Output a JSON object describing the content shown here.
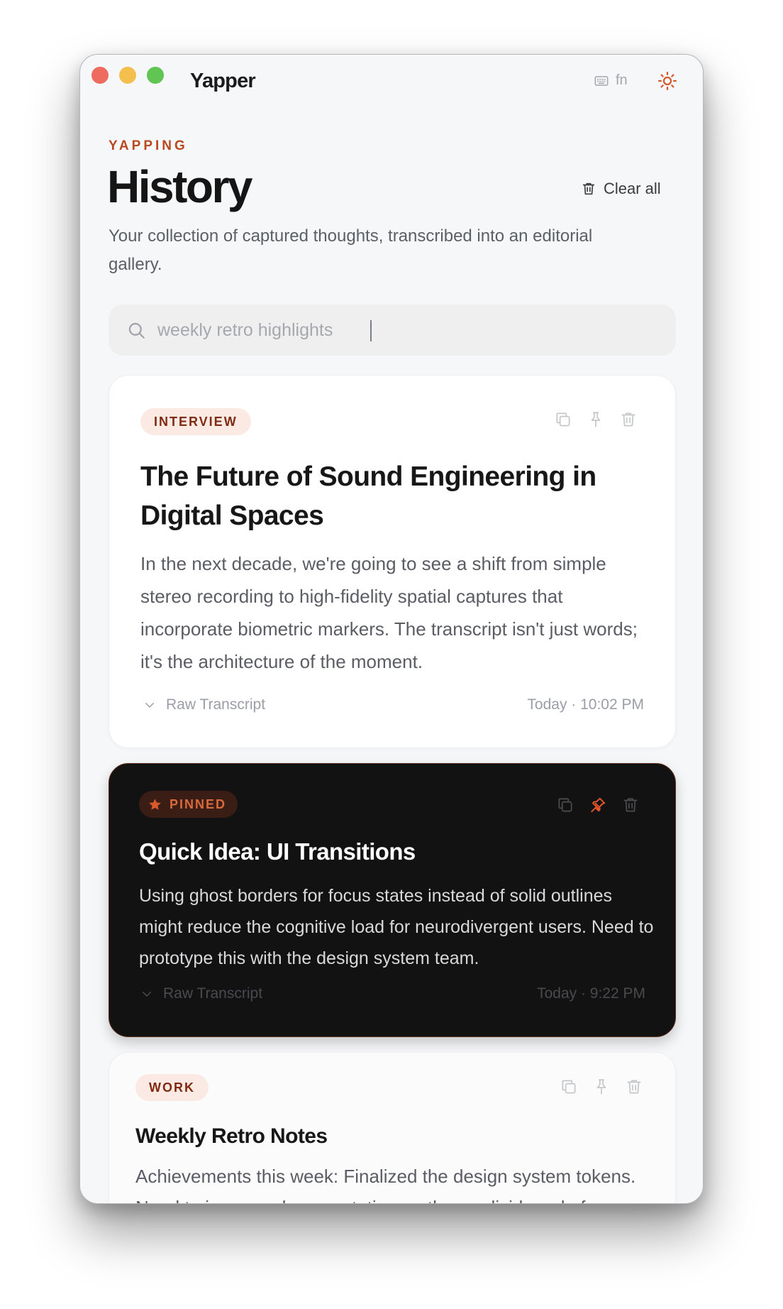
{
  "app": {
    "title": "Yapper",
    "hotkey_label": "fn"
  },
  "header": {
    "eyebrow": "YAPPING",
    "title": "History",
    "subtitle": "Your collection of captured thoughts, transcribed into an editorial gallery.",
    "clear_all_label": "Clear all"
  },
  "search": {
    "value": "weekly retro highlights"
  },
  "icons": {
    "search": "search-icon",
    "trash": "trash-icon",
    "copy": "copy-icon",
    "pin": "pin-icon",
    "star": "star-icon",
    "chevron": "chevron-down-icon",
    "keyboard": "keyboard-icon",
    "sun": "sun-icon"
  },
  "colors": {
    "accent": "#b8481f",
    "tag_bg": "#fbeae4",
    "tag_text": "#7f2a12",
    "pinned_card_bg": "#131212",
    "pin_active": "#e0562a"
  },
  "entries": [
    {
      "tag": "INTERVIEW",
      "title": "The Future of Sound Engineering in Digital Spaces",
      "body": "In the next decade, we're going to see a shift from simple stereo recording to high-fidelity spatial captures that incorporate biometric markers. The transcript isn't just words; it's the architecture of the moment.",
      "raw_label": "Raw Transcript",
      "timestamp": "Today · 10:02 PM",
      "pinned": false
    },
    {
      "tag": "PINNED",
      "title": "Quick Idea: UI Transitions",
      "body": "Using ghost borders for focus states instead of solid outlines might reduce the cognitive load for neurodivergent users. Need to prototype this with the design system team.",
      "raw_label": "Raw Transcript",
      "timestamp": "Today · 9:22 PM",
      "pinned": true
    },
    {
      "tag": "WORK",
      "title": "Weekly Retro Notes",
      "body": "Achievements this week: Finalized the design system tokens. Need to improve documentation on the no-divider rule for",
      "pinned": false
    }
  ]
}
